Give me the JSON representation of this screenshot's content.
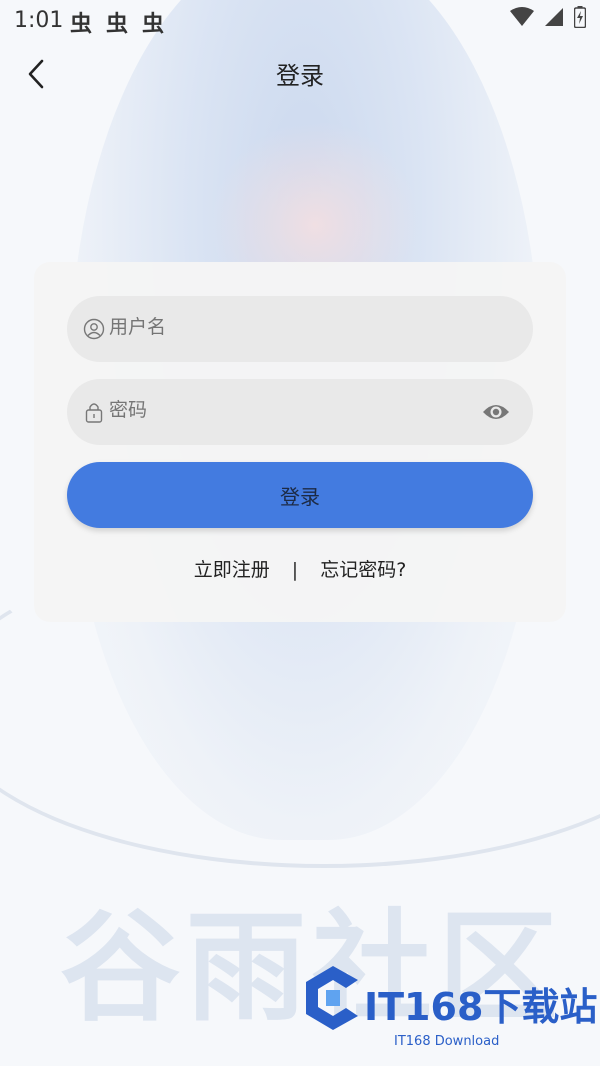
{
  "status_bar": {
    "time": "1:01",
    "notifications": [
      "虫",
      "虫",
      "虫"
    ]
  },
  "header": {
    "title": "登录"
  },
  "login_form": {
    "username_placeholder": "用户名",
    "password_placeholder": "密码",
    "submit_label": "登录",
    "register_link": "立即注册",
    "separator": "|",
    "forgot_link": "忘记密码?"
  },
  "background": {
    "decor_text": "谷雨社区"
  },
  "watermark": {
    "title": "IT168下载站",
    "subtitle": "IT168 Download"
  },
  "colors": {
    "accent": "#437be0",
    "card_bg": "#f5f5f5",
    "field_bg": "#e9e9e9"
  },
  "icons": [
    "back-icon",
    "user-icon",
    "lock-icon",
    "eye-icon",
    "wifi-icon",
    "signal-icon",
    "battery-icon"
  ]
}
